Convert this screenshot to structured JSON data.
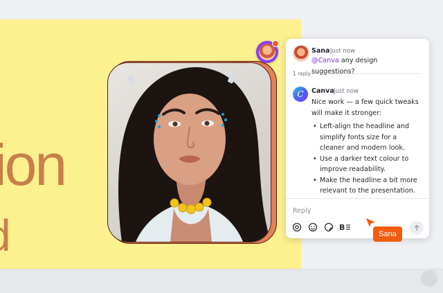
{
  "slide": {
    "headline_fragment": "sion",
    "sub_fragment": "d",
    "text_color": "#c87f4a",
    "background": "#fdf08e"
  },
  "comments": {
    "first": {
      "author": "Sana",
      "time": "Just now",
      "mention": "@Canva",
      "text": " any design suggestions?"
    },
    "reply_count": "1 reply",
    "second": {
      "author": "Canva",
      "avatar_letter": "C",
      "time": "Just now",
      "intro": "Nice work — a few quick tweaks will make it stronger:",
      "tips": [
        "Left-align the headline and simplify fonts size for a cleaner and modern look.",
        "Use a darker text colour to improve readability.",
        "Make the headline a bit more relevant to the presentation."
      ]
    }
  },
  "reply_box": {
    "placeholder": "Reply",
    "tools": [
      "mention-icon",
      "emoji-icon",
      "sticker-icon",
      "bold-list-icon"
    ],
    "send_icon": "arrow-up-icon"
  },
  "cursor": {
    "label": "Sana",
    "color": "#f25c0f"
  },
  "accent": "#7d2ae8"
}
